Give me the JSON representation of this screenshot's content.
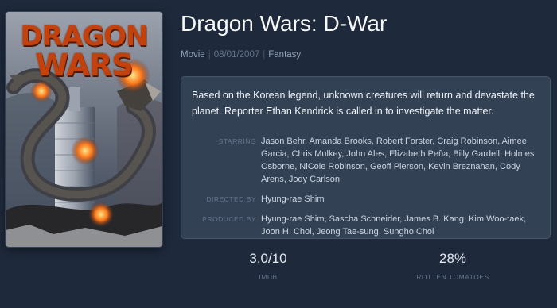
{
  "poster": {
    "title_line1": "DRAGON",
    "title_line2": "WARS"
  },
  "movie": {
    "title": "Dragon Wars: D-War",
    "type": "Movie",
    "release_date": "08/01/2007",
    "genre": "Fantasy"
  },
  "details": {
    "description": "Based on the Korean legend, unknown creatures will return and devastate the planet. Reporter Ethan Kendrick is called in to investigate the matter.",
    "credits": [
      {
        "label": "STARRING",
        "value": "Jason Behr, Amanda Brooks, Robert Forster, Craig Robinson, Aimee Garcia, Chris Mulkey, John Ales, Elizabeth Peña, Billy Gardell, Holmes Osborne, NiCole Robinson, Geoff Pierson, Kevin Breznahan, Cody Arens, Jody Carlson"
      },
      {
        "label": "DIRECTED BY",
        "value": "Hyung-rae Shim"
      },
      {
        "label": "PRODUCED BY",
        "value": "Hyung-rae Shim, Sascha Schneider, James B. Kang, Kim Woo-taek, Joon H. Choi, Jeong Tae-sung, Sungho Choi"
      }
    ]
  },
  "ratings": {
    "imdb": {
      "value": "3.0/10",
      "label": "IMDB"
    },
    "rotten_tomatoes": {
      "value": "28%",
      "label": "ROTTEN TOMATOES"
    }
  },
  "colors": {
    "background": "#1e293b",
    "card": "#334155",
    "poster_title": "#c2410c"
  }
}
